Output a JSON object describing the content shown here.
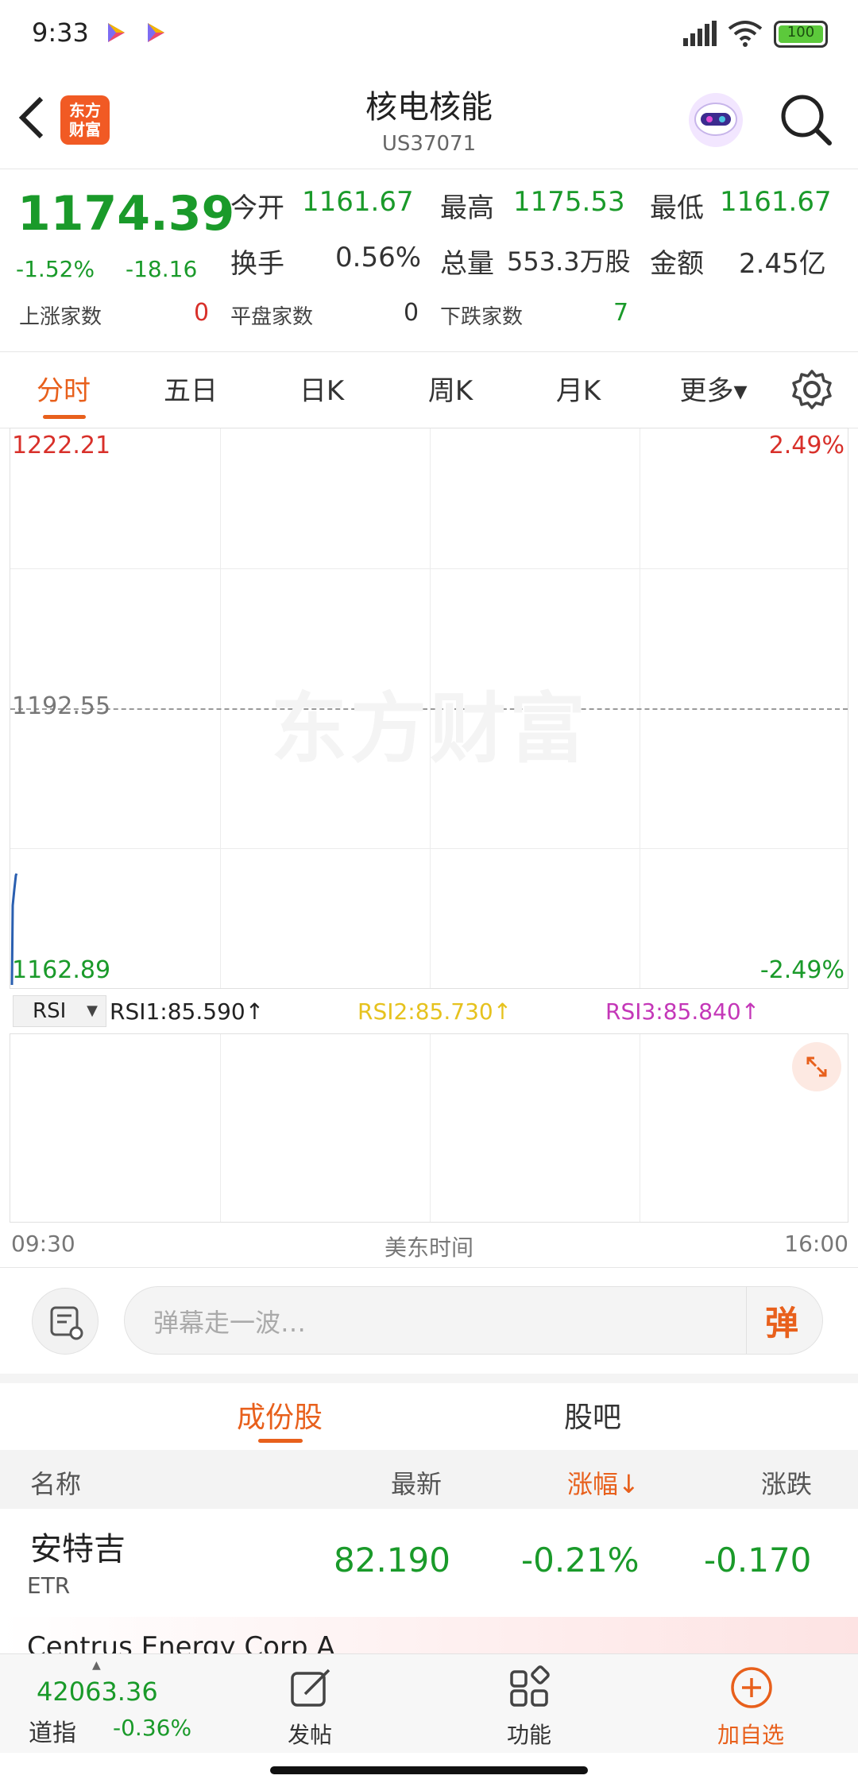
{
  "status_bar": {
    "time": "9:33",
    "battery": "100"
  },
  "header": {
    "title": "核电核能",
    "code": "US37071",
    "logo_text": "东方\n财富"
  },
  "quote": {
    "price": "1174.39",
    "change_pct": "-1.52%",
    "change": "-18.16",
    "open_label": "今开",
    "open": "1161.67",
    "high_label": "最高",
    "high": "1175.53",
    "low_label": "最低",
    "low": "1161.67",
    "turnover_label": "换手",
    "turnover": "0.56%",
    "volume_label": "总量",
    "volume": "553.3万股",
    "amount_label": "金额",
    "amount": "2.45亿",
    "up_label": "上涨家数",
    "up": "0",
    "flat_label": "平盘家数",
    "flat": "0",
    "down_label": "下跌家数",
    "down": "7"
  },
  "tabs": [
    {
      "label": "分时",
      "active": true
    },
    {
      "label": "五日"
    },
    {
      "label": "日K"
    },
    {
      "label": "周K"
    },
    {
      "label": "月K"
    },
    {
      "label": "更多▾"
    }
  ],
  "chart": {
    "y_top": "1222.21",
    "y_mid": "1192.55",
    "y_bottom": "1162.89",
    "pct_top": "2.49%",
    "pct_bottom": "-2.49%",
    "watermark": "东方财富"
  },
  "rsi": {
    "selector": "RSI",
    "rsi1": "RSI1:85.590↑",
    "rsi2": "RSI2:85.730↑",
    "rsi3": "RSI3:85.840↑"
  },
  "time_axis": {
    "start": "09:30",
    "label": "美东时间",
    "end": "16:00"
  },
  "danmu": {
    "placeholder": "弹幕走一波…",
    "button": "弹"
  },
  "subtabs": [
    {
      "label": "成份股",
      "active": true
    },
    {
      "label": "股吧"
    }
  ],
  "table": {
    "headers": {
      "name": "名称",
      "latest": "最新",
      "pct": "涨幅↓",
      "change": "涨跌"
    },
    "rows": [
      {
        "name": "安特吉",
        "code": "ETR",
        "latest": "82.190",
        "pct": "-0.21%",
        "change": "-0.170"
      },
      {
        "name": "Centrus Energy Corp A"
      }
    ]
  },
  "bottom_nav": {
    "index_value": "42063.36",
    "index_name": "道指",
    "index_pct": "-0.36%",
    "post": "发帖",
    "functions": "功能",
    "add": "加自选"
  },
  "colors": {
    "up": "#d8302a",
    "down": "#1a9a2a",
    "accent": "#e8601c",
    "rsi2": "#e6c21e",
    "rsi3": "#c437b8"
  }
}
